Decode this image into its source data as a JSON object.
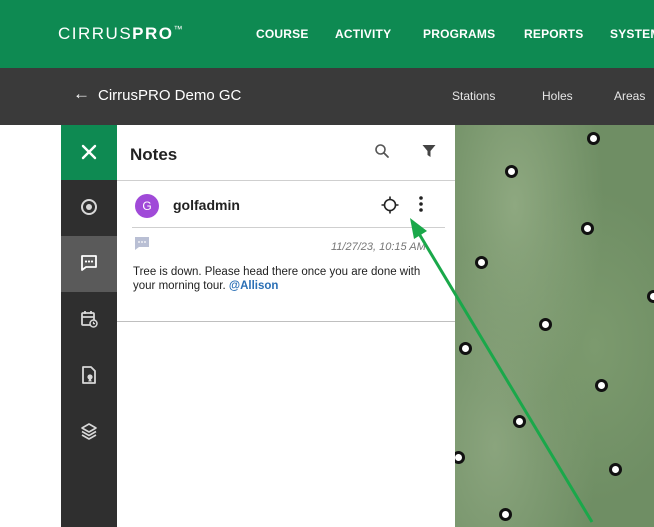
{
  "brand": {
    "part1": "CIRRUS",
    "part2": "PRO",
    "tm": "™"
  },
  "nav": {
    "items": [
      "COURSE",
      "ACTIVITY",
      "PROGRAMS",
      "REPORTS",
      "SYSTEM"
    ]
  },
  "subheader": {
    "back_icon": "←",
    "course_title": "CirrusPRO Demo GC",
    "tabs": [
      "Stations",
      "Holes",
      "Areas"
    ]
  },
  "rail": {
    "icons": [
      "close-icon",
      "target-icon",
      "notes-icon",
      "calendar-icon",
      "map-file-icon",
      "layers-icon"
    ]
  },
  "notes_panel": {
    "title": "Notes",
    "note": {
      "avatar_letter": "G",
      "author": "golfadmin",
      "timestamp": "11/27/23, 10:15 AM",
      "text": "Tree is down. Please head there once you are done with your morning tour.",
      "mention": "@Allison"
    }
  },
  "colors": {
    "accent_green": "#0e8a52",
    "avatar_purple": "#a04ad8",
    "mention_blue": "#2a6fb5",
    "annotation_arrow": "#1aa84a"
  }
}
